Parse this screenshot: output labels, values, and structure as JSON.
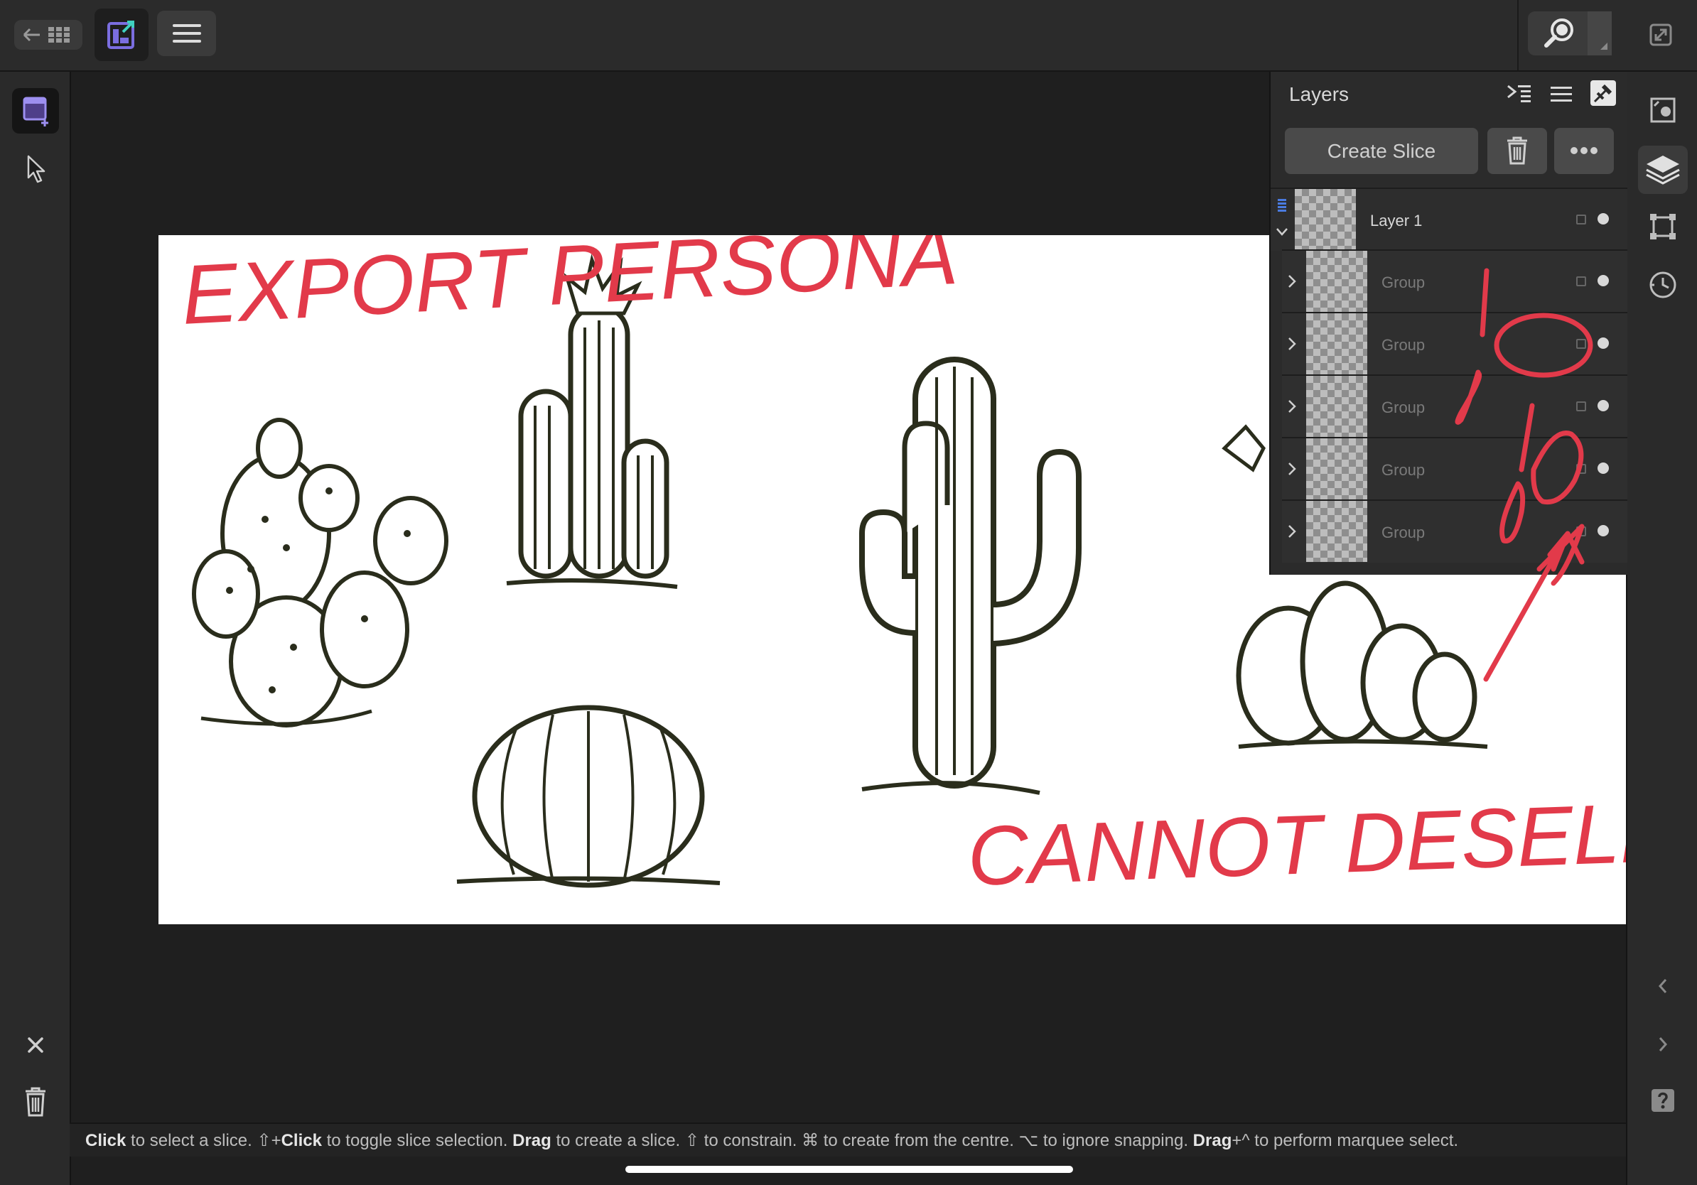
{
  "toolbar": {
    "back_grid_icon": "back-to-gallery-icon",
    "export_persona_icon": "export-persona-icon",
    "menu_icon": "hamburger-menu-icon",
    "zoom_icon": "zoom-icon",
    "fullscreen_icon": "fullscreen-icon"
  },
  "left_tools": {
    "slice_tool": "slice-tool-icon",
    "select_tool": "pointer-icon",
    "close": "close-icon",
    "delete": "trash-icon"
  },
  "canvas": {
    "handwriting_top": "EXPORT PERSONA",
    "handwriting_bottom": "CANNOT DESELECT"
  },
  "layers_panel": {
    "title": "Layers",
    "create_slice_label": "Create Slice",
    "rows": [
      {
        "name": "Layer 1"
      },
      {
        "name": "Group"
      },
      {
        "name": "Group"
      },
      {
        "name": "Group"
      },
      {
        "name": "Group"
      },
      {
        "name": "Group"
      }
    ]
  },
  "status": {
    "p1": "Click",
    "p2": " to select a slice. ⇧+",
    "p3": "Click",
    "p4": " to toggle slice selection. ",
    "p5": "Drag",
    "p6": " to create a slice. ⇧ to constrain. ⌘ to create from the centre. ⌥ to ignore snapping. ",
    "p7": "Drag",
    "p8": "+^ to perform marquee select."
  },
  "colors": {
    "accent": "#7b6ee0",
    "annotation": "#e23a4a",
    "ink": "#2a2d1c"
  }
}
